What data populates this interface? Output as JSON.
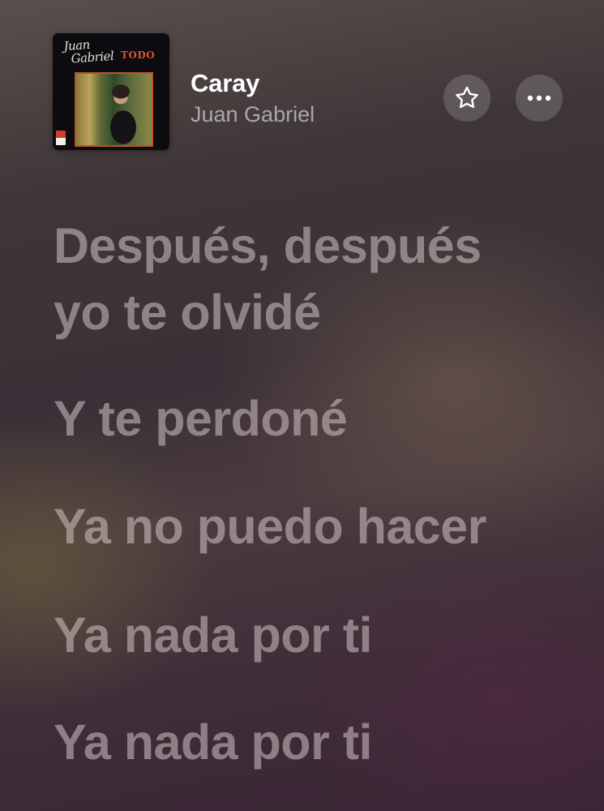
{
  "now_playing": {
    "title": "Caray",
    "artist": "Juan Gabriel",
    "album_art": {
      "script_line1": "Juan",
      "script_line2": "Gabriel",
      "album_name": "TODO"
    }
  },
  "actions": {
    "favorite_icon": "star-icon",
    "more_icon": "ellipsis-icon"
  },
  "lyrics": {
    "lines": [
      {
        "line1": "Después, después",
        "line2": "yo te olvidé"
      },
      {
        "line1": "Y te perdoné"
      },
      {
        "line1": "Ya no puedo hacer"
      },
      {
        "line1": "Ya nada por ti"
      },
      {
        "line1": "Ya nada por ti"
      }
    ]
  },
  "colors": {
    "title": "#ffffff",
    "artist": "#9b9396",
    "lyric_inactive": "#b3a5a8",
    "button_bg": "#5a5052"
  }
}
